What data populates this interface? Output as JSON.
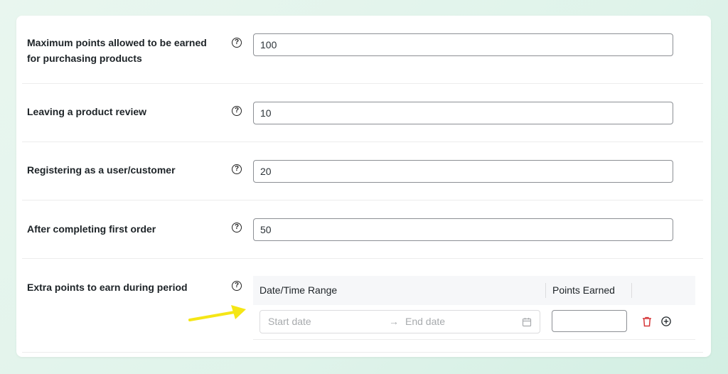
{
  "settings": {
    "max_points": {
      "label": "Maximum points allowed to be earned for purchasing products",
      "value": "100"
    },
    "product_review": {
      "label": "Leaving a product review",
      "value": "10"
    },
    "register": {
      "label": "Registering as a user/customer",
      "value": "20"
    },
    "first_order": {
      "label": "After completing first order",
      "value": "50"
    },
    "extra_points": {
      "label": "Extra points to earn during period",
      "table": {
        "col_range": "Date/Time Range",
        "col_points": "Points Earned",
        "start_placeholder": "Start date",
        "end_placeholder": "End date",
        "separator": "→",
        "points_value": ""
      }
    }
  },
  "help_glyph": "?",
  "icons": {
    "help": "question-circle-icon",
    "calendar": "calendar-icon",
    "delete": "trash-icon",
    "add": "plus-circle-icon",
    "annotation": "arrow-icon"
  },
  "colors": {
    "delete_icon": "#d63638",
    "annotation_arrow": "#f5e616",
    "background": "#e3f4ec"
  }
}
